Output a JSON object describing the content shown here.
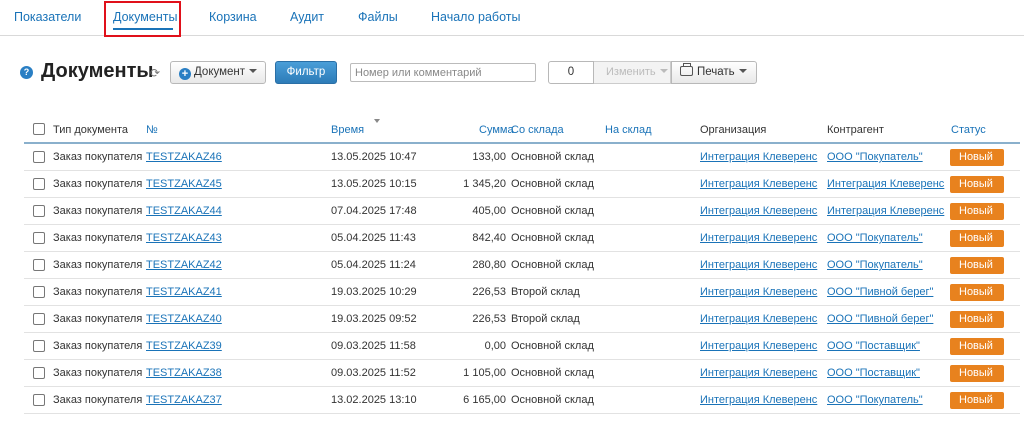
{
  "nav": {
    "tabs": [
      {
        "label": "Показатели"
      },
      {
        "label": "Документы"
      },
      {
        "label": "Корзина"
      },
      {
        "label": "Аудит"
      },
      {
        "label": "Файлы"
      },
      {
        "label": "Начало работы"
      }
    ],
    "active_index": 1
  },
  "toolbar": {
    "title": "Документы",
    "help_glyph": "?",
    "refresh_glyph": "⟳",
    "document_button": "Документ",
    "filter_button": "Фильтр",
    "search_placeholder": "Номер или комментарий",
    "selected_count": "0",
    "change_button": "Изменить",
    "print_button": "Печать"
  },
  "table": {
    "columns": {
      "type": "Тип документа",
      "number": "№",
      "time": "Время",
      "sum": "Сумма",
      "from_store": "Со склада",
      "to_store": "На склад",
      "org": "Организация",
      "agent": "Контрагент",
      "status": "Статус"
    },
    "rows": [
      {
        "type": "Заказ покупателя",
        "number": "TESTZAKAZ46",
        "time": "13.05.2025 10:47",
        "sum": "133,00",
        "from_store": "Основной склад",
        "to_store": "",
        "org": "Интеграция Клеверенс",
        "agent": "ООО \"Покупатель\"",
        "status": "Новый"
      },
      {
        "type": "Заказ покупателя",
        "number": "TESTZAKAZ45",
        "time": "13.05.2025 10:15",
        "sum": "1 345,20",
        "from_store": "Основной склад",
        "to_store": "",
        "org": "Интеграция Клеверенс",
        "agent": "Интеграция Клеверенс",
        "status": "Новый"
      },
      {
        "type": "Заказ покупателя",
        "number": "TESTZAKAZ44",
        "time": "07.04.2025 17:48",
        "sum": "405,00",
        "from_store": "Основной склад",
        "to_store": "",
        "org": "Интеграция Клеверенс",
        "agent": "Интеграция Клеверенс",
        "status": "Новый"
      },
      {
        "type": "Заказ покупателя",
        "number": "TESTZAKAZ43",
        "time": "05.04.2025 11:43",
        "sum": "842,40",
        "from_store": "Основной склад",
        "to_store": "",
        "org": "Интеграция Клеверенс",
        "agent": "ООО \"Покупатель\"",
        "status": "Новый"
      },
      {
        "type": "Заказ покупателя",
        "number": "TESTZAKAZ42",
        "time": "05.04.2025 11:24",
        "sum": "280,80",
        "from_store": "Основной склад",
        "to_store": "",
        "org": "Интеграция Клеверенс",
        "agent": "ООО \"Покупатель\"",
        "status": "Новый"
      },
      {
        "type": "Заказ покупателя",
        "number": "TESTZAKAZ41",
        "time": "19.03.2025 10:29",
        "sum": "226,53",
        "from_store": "Второй склад",
        "to_store": "",
        "org": "Интеграция Клеверенс",
        "agent": "ООО \"Пивной берег\"",
        "status": "Новый"
      },
      {
        "type": "Заказ покупателя",
        "number": "TESTZAKAZ40",
        "time": "19.03.2025 09:52",
        "sum": "226,53",
        "from_store": "Второй склад",
        "to_store": "",
        "org": "Интеграция Клеверенс",
        "agent": "ООО \"Пивной берег\"",
        "status": "Новый"
      },
      {
        "type": "Заказ покупателя",
        "number": "TESTZAKAZ39",
        "time": "09.03.2025 11:58",
        "sum": "0,00",
        "from_store": "Основной склад",
        "to_store": "",
        "org": "Интеграция Клеверенс",
        "agent": "ООО \"Поставщик\"",
        "status": "Новый"
      },
      {
        "type": "Заказ покупателя",
        "number": "TESTZAKAZ38",
        "time": "09.03.2025 11:52",
        "sum": "1 105,00",
        "from_store": "Основной склад",
        "to_store": "",
        "org": "Интеграция Клеверенс",
        "agent": "ООО \"Поставщик\"",
        "status": "Новый"
      },
      {
        "type": "Заказ покупателя",
        "number": "TESTZAKAZ37",
        "time": "13.02.2025 13:10",
        "sum": "6 165,00",
        "from_store": "Основной склад",
        "to_store": "",
        "org": "Интеграция Клеверенс",
        "agent": "ООО \"Покупатель\"",
        "status": "Новый"
      }
    ]
  },
  "colors": {
    "link": "#1a73b8",
    "status_new": "#e8821e",
    "active_tab_outline": "#e0101a",
    "filter_button": "#2d7cb8"
  }
}
